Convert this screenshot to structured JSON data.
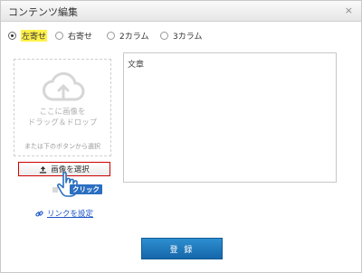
{
  "dialog": {
    "title": "コンテンツ編集",
    "close_icon": "×"
  },
  "layout_options": [
    {
      "label": "左寄せ",
      "checked": true
    },
    {
      "label": "右寄せ",
      "checked": false
    },
    {
      "label": "2カラム",
      "checked": false
    },
    {
      "label": "3カラム",
      "checked": false
    }
  ],
  "image_area": {
    "dropzone_icon": "cloud-upload-icon",
    "dropzone_line1": "ここに画像を",
    "dropzone_line2": "ドラッグ＆ドロップ",
    "dropzone_subtext": "または下のボタンから選択",
    "select_button_label": "画像を選択",
    "select_button_icon": "upload-icon",
    "cursor_icon": "hand-pointer-icon",
    "click_badge": "クリック",
    "link_label": "リンクを設定",
    "link_icon": "link-icon"
  },
  "text_area": {
    "label": "文章"
  },
  "submit_button_label": "登 録",
  "colors": {
    "primary": "#1a75bc",
    "highlight": "#fff14a",
    "select_border": "#d00000",
    "link": "#1a53c6",
    "badge": "#2a6fc1"
  }
}
